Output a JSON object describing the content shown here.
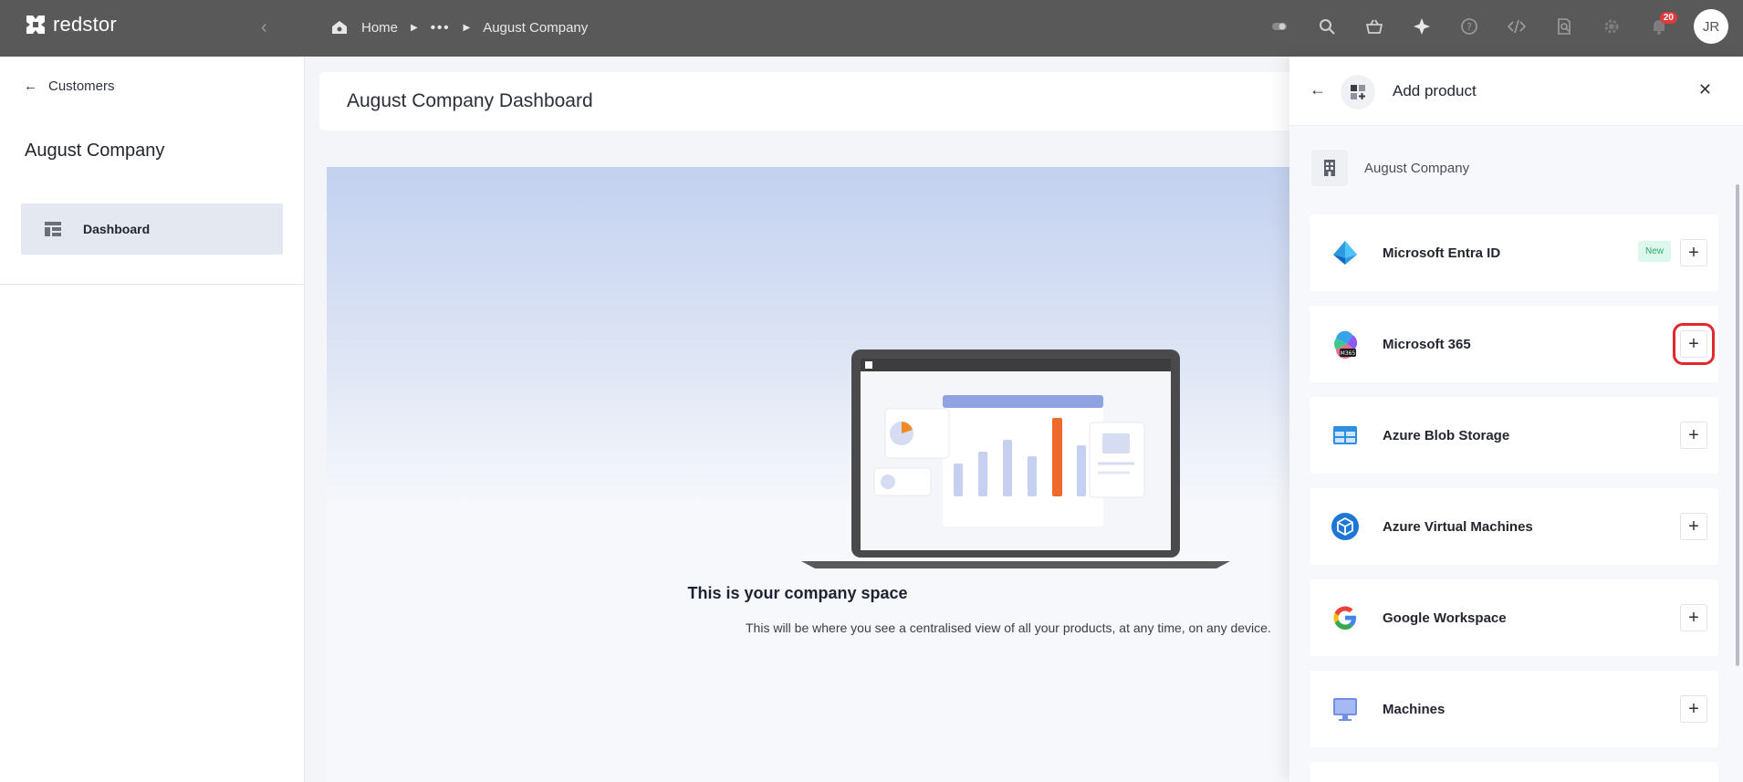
{
  "topbar": {
    "brand": "redstor",
    "breadcrumb": {
      "home": "Home",
      "ellipsis": "•••",
      "current": "August Company"
    },
    "notifications_count": "20",
    "avatar_initials": "JR"
  },
  "sidebar": {
    "back_label": "Customers",
    "company_name": "August Company",
    "nav": [
      {
        "label": "Dashboard",
        "icon": "dashboard-icon"
      }
    ]
  },
  "main": {
    "header_title": "August Company Dashboard",
    "hero_title": "This is your company space",
    "hero_text": "This will be where you see a centralised view of all your products, at any time, on any device."
  },
  "panel": {
    "title": "Add product",
    "company": "August Company",
    "products": [
      {
        "name": "Microsoft Entra ID",
        "badge": "New",
        "icon": "entra-icon"
      },
      {
        "name": "Microsoft 365",
        "icon": "m365-icon"
      },
      {
        "name": "Azure Blob Storage",
        "icon": "blob-storage-icon"
      },
      {
        "name": "Azure Virtual Machines",
        "icon": "azure-vm-icon"
      },
      {
        "name": "Google Workspace",
        "icon": "google-icon"
      },
      {
        "name": "Machines",
        "icon": "monitor-icon"
      }
    ]
  },
  "colors": {
    "topbar": "#595959",
    "highlight": "#e0282e",
    "new_badge": "#2aa86b",
    "accent_orange": "#f08a24"
  }
}
